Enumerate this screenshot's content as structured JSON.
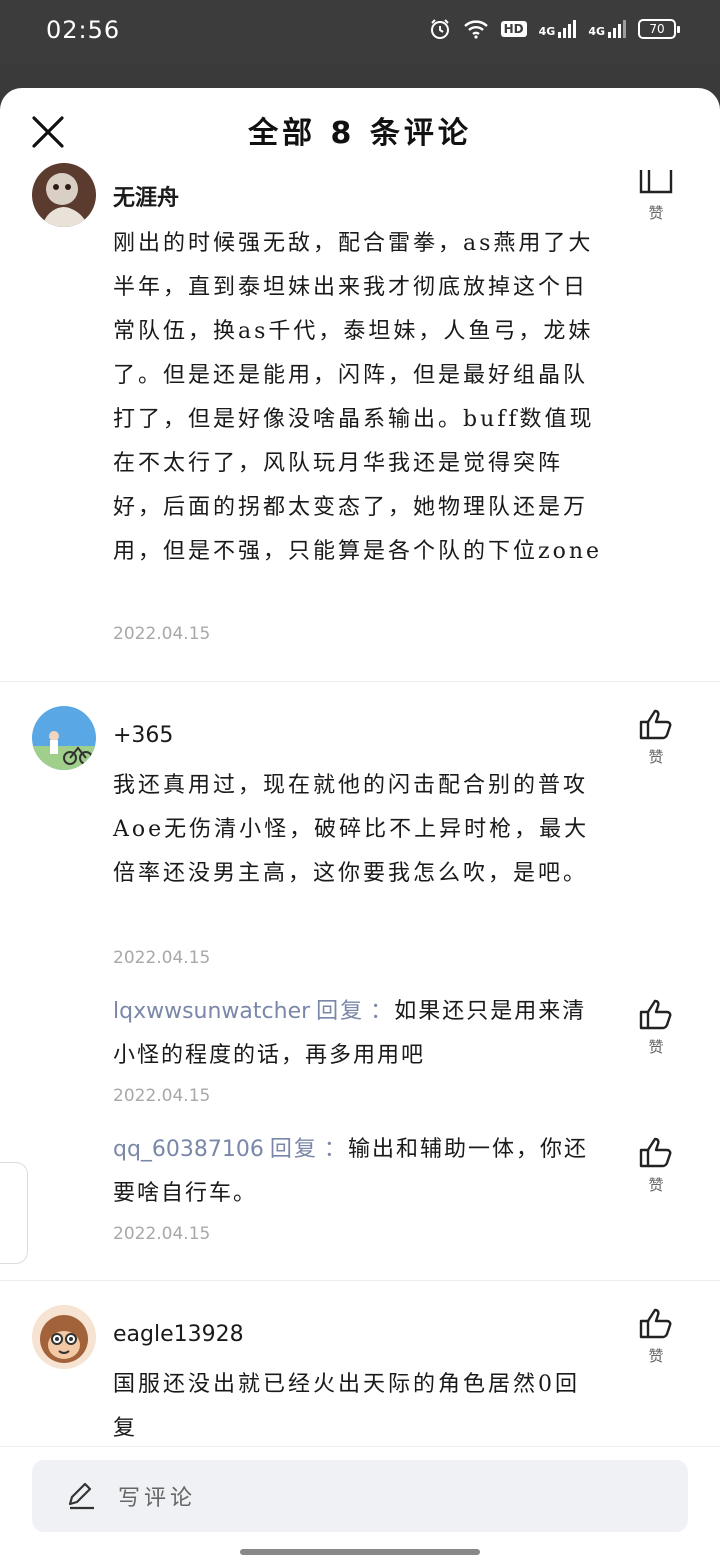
{
  "status_bar": {
    "time": "02:56",
    "hd_label": "HD",
    "net1": "4G",
    "net2": "4G",
    "battery": "70"
  },
  "sheet": {
    "title": "全部 8 条评论"
  },
  "like_label": "赞",
  "comments": [
    {
      "username": "无涯舟",
      "text": "刚出的时候强无敌，配合雷拳，as燕用了大半年，直到泰坦妹出来我才彻底放掉这个日常队伍，换as千代，泰坦妹，人鱼弓，龙妹了。但是还是能用，闪阵，但是最好组晶队打了，但是好像没啥晶系输出。buff数值现在不太行了，风队玩月华我还是觉得突阵好，后面的拐都太变态了，她物理队还是万用，但是不强，只能算是各个队的下位zone",
      "date": "2022.04.15"
    },
    {
      "username": "+365",
      "text": "我还真用过，现在就他的闪击配合别的普攻Aoe无伤清小怪，破碎比不上异时枪，最大倍率还没男主高，这你要我怎么吹，是吧。",
      "date": "2022.04.15",
      "replies": [
        {
          "user": "lqxwwsunwatcher",
          "reply_word": "回复",
          "text": "如果还只是用来清小怪的程度的话，再多用用吧",
          "date": "2022.04.15"
        },
        {
          "user": "qq_60387106",
          "reply_word": "回复",
          "text": "输出和辅助一体，你还要啥自行车。",
          "date": "2022.04.15"
        }
      ]
    },
    {
      "username": "eagle13928",
      "text": "国服还没出就已经火出天际的角色居然0回复"
    }
  ],
  "bottom": {
    "placeholder": "写评论"
  }
}
